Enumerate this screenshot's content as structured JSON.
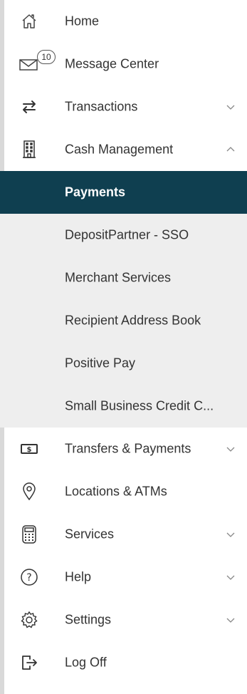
{
  "menu": {
    "home": {
      "label": "Home",
      "icon": "home-icon"
    },
    "messages": {
      "label": "Message Center",
      "badge": "10",
      "icon": "envelope-icon"
    },
    "transactions": {
      "label": "Transactions",
      "icon": "arrows-exchange-icon"
    },
    "cash_management": {
      "label": "Cash Management",
      "icon": "building-icon",
      "expanded": true,
      "submenu": [
        {
          "label": "Payments",
          "active": true
        },
        {
          "label": "DepositPartner - SSO"
        },
        {
          "label": "Merchant Services"
        },
        {
          "label": "Recipient Address Book"
        },
        {
          "label": "Positive Pay"
        },
        {
          "label": "Small Business Credit C..."
        }
      ]
    },
    "transfers": {
      "label": "Transfers & Payments",
      "icon": "money-icon"
    },
    "locations": {
      "label": "Locations & ATMs",
      "icon": "location-pin-icon"
    },
    "services": {
      "label": "Services",
      "icon": "calculator-icon"
    },
    "help": {
      "label": "Help",
      "icon": "question-icon"
    },
    "settings": {
      "label": "Settings",
      "icon": "gear-icon"
    },
    "logoff": {
      "label": "Log Off",
      "icon": "logout-icon"
    }
  },
  "colors": {
    "active_bg": "#0f3f50",
    "submenu_bg": "#eeeeee",
    "text": "#333333"
  }
}
